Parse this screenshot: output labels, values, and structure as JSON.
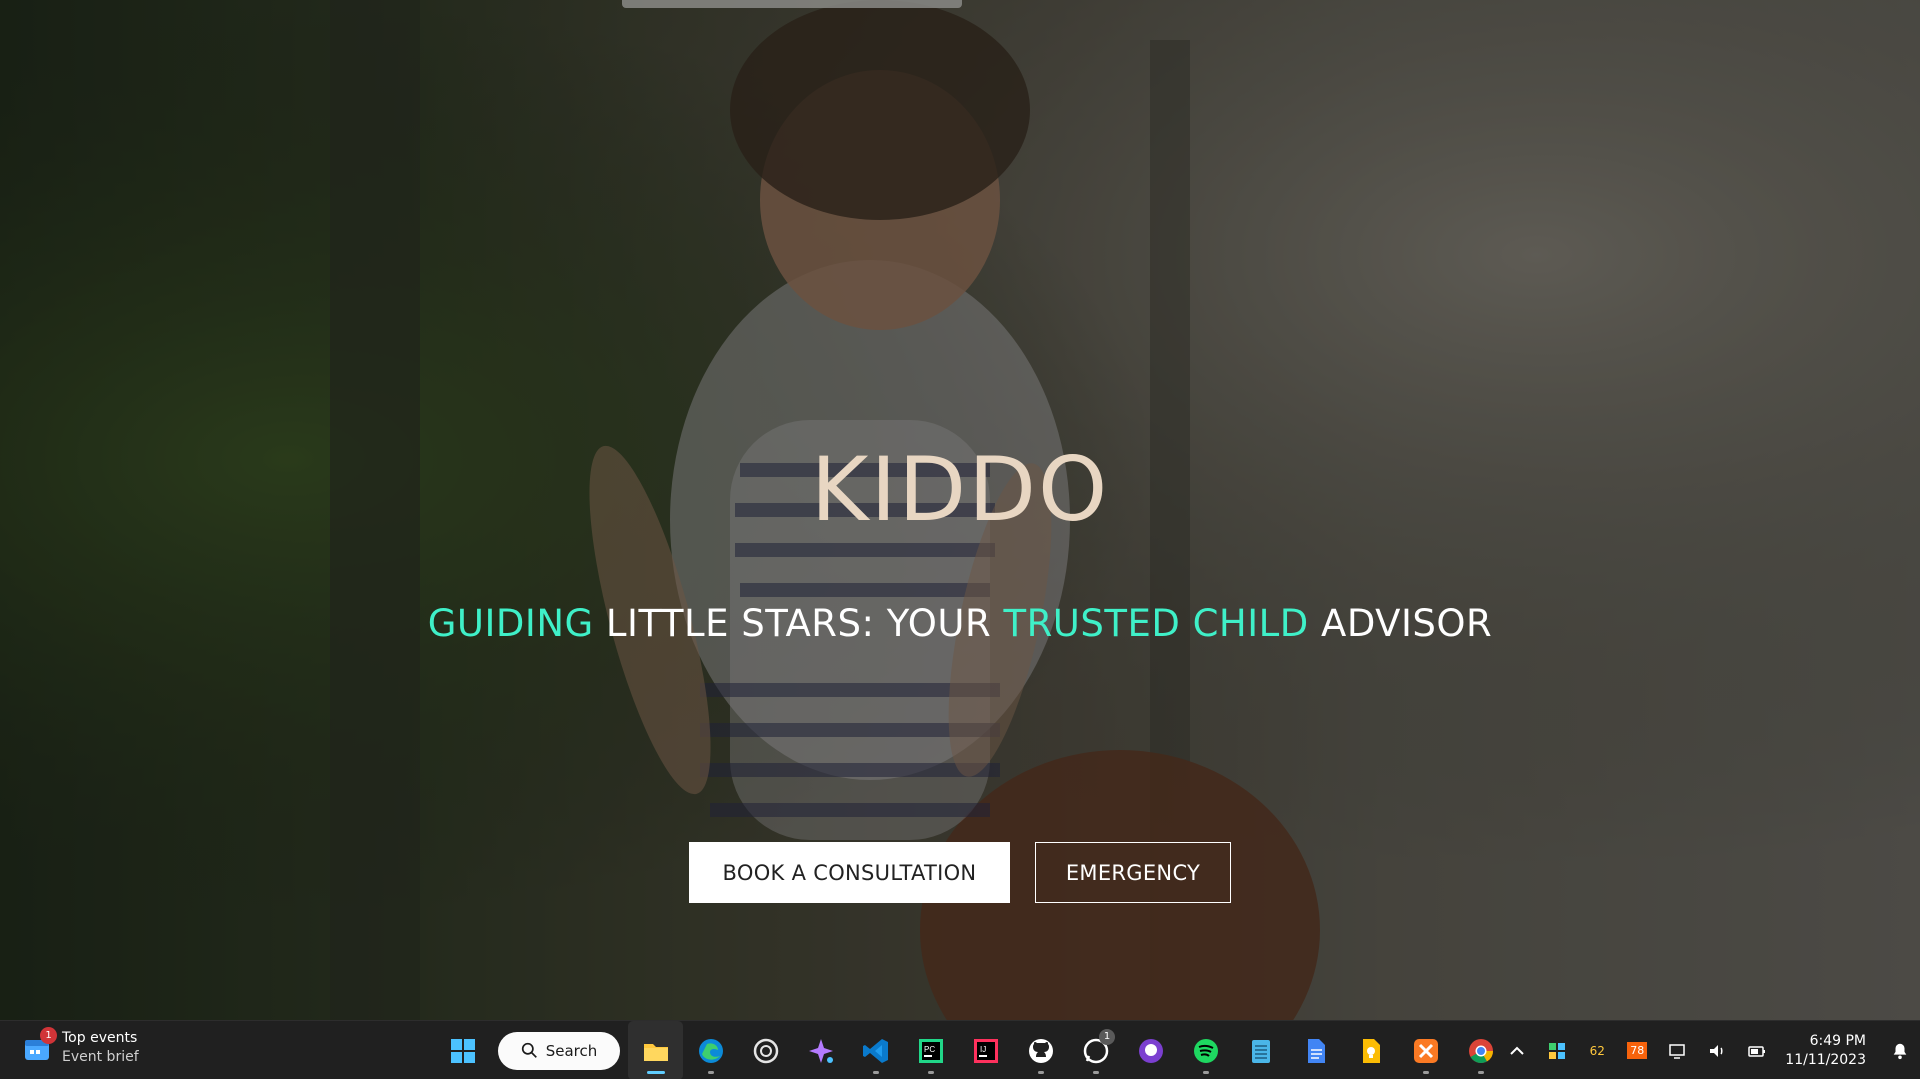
{
  "hero": {
    "brand": "KIDDO",
    "tagline": {
      "part1": "GUIDING",
      "part2": " LITTLE STARS: YOUR ",
      "part3": "TRUSTED CHILD",
      "part4": " ADVISOR"
    },
    "buttons": {
      "primary": "BOOK A CONSULTATION",
      "secondary": "EMERGENCY"
    },
    "colors": {
      "brand": "#e8d6c2",
      "accent": "#3ff0c8"
    }
  },
  "taskbar": {
    "widget": {
      "title": "Top events",
      "subtitle": "Event brief",
      "badge": "1"
    },
    "search_label": "Search",
    "apps": [
      {
        "icon": "windows-start-icon"
      },
      {
        "icon": "file-explorer-icon"
      },
      {
        "icon": "edge-browser-icon"
      },
      {
        "icon": "chatgpt-icon"
      },
      {
        "icon": "copilot-icon"
      },
      {
        "icon": "vscode-icon"
      },
      {
        "icon": "pycharm-icon"
      },
      {
        "icon": "intellij-icon"
      },
      {
        "icon": "github-icon"
      },
      {
        "icon": "whatsapp-icon",
        "badge": "1"
      },
      {
        "icon": "github-desktop-icon"
      },
      {
        "icon": "spotify-icon"
      },
      {
        "icon": "notepad-icon"
      },
      {
        "icon": "google-docs-icon"
      },
      {
        "icon": "google-keep-icon"
      },
      {
        "icon": "xampp-icon"
      },
      {
        "icon": "chrome-icon"
      }
    ],
    "tray": {
      "temp1": "62",
      "temp2": "78",
      "time": "6:49 PM",
      "date": "11/11/2023"
    }
  }
}
